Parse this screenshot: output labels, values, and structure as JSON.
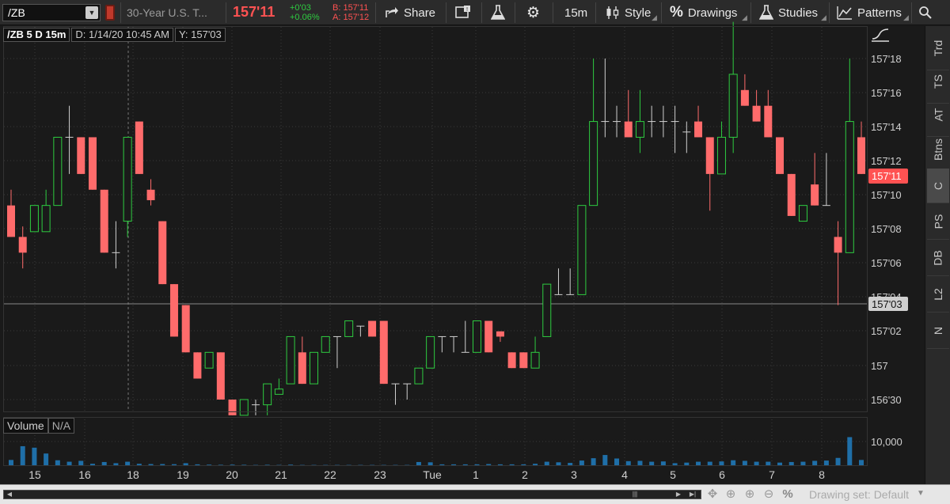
{
  "toolbar": {
    "symbol": "/ZB",
    "description": "30-Year U.S. T...",
    "last_price": "157'11",
    "net_change": "+0'03",
    "pct_change": "+0.06%",
    "bid": "B: 157'11",
    "ask": "A: 157'12",
    "share_label": "Share",
    "timeframe_label": "15m",
    "style_label": "Style",
    "drawings_label": "Drawings",
    "studies_label": "Studies",
    "patterns_label": "Patterns"
  },
  "chart_header": {
    "id": "/ZB 5 D 15m",
    "date": "D: 1/14/20 10:45 AM",
    "y": "Y: 157'03"
  },
  "volume_header": {
    "label": "Volume",
    "value": "N/A"
  },
  "sidebar": {
    "items": [
      "Trd",
      "TS",
      "AT",
      "Btns",
      "C",
      "PS",
      "DB",
      "L2",
      "N"
    ],
    "active": "C"
  },
  "bottombar": {
    "drawing_set": "Drawing set: Default"
  },
  "colors": {
    "up": "#2ecc40",
    "down": "#ff6b6b",
    "grid": "#3a3a3a",
    "bg": "#1a1a1a"
  },
  "chart_data": [
    {
      "type": "candlestick",
      "title": "/ZB 5 D 15m",
      "x_tick_labels": [
        "15",
        "16",
        "18",
        "19",
        "20",
        "21",
        "22",
        "23",
        "Tue",
        "1",
        "2",
        "3",
        "4",
        "5",
        "6",
        "7",
        "8"
      ],
      "y_tick_labels": [
        "156'30",
        "157",
        "157'02",
        "157'04",
        "157'06",
        "157'08",
        "157'10",
        "157'12",
        "157'14",
        "157'16",
        "157'18"
      ],
      "ylim": [
        156.9,
        157.6
      ],
      "last_price_label": "157'11",
      "crosshair_price_label": "157'03",
      "crosshair_value": 157.09,
      "grid": true,
      "candles": [
        {
          "o": 157.31,
          "h": 157.34,
          "l": 157.25,
          "c": 157.25
        },
        {
          "o": 157.25,
          "h": 157.27,
          "l": 157.19,
          "c": 157.22
        },
        {
          "o": 157.26,
          "h": 157.31,
          "l": 157.26,
          "c": 157.31
        },
        {
          "o": 157.26,
          "h": 157.34,
          "l": 157.26,
          "c": 157.31
        },
        {
          "o": 157.31,
          "h": 157.44,
          "l": 157.31,
          "c": 157.44
        },
        {
          "o": 157.44,
          "h": 157.5,
          "l": 157.37,
          "c": 157.44
        },
        {
          "o": 157.44,
          "h": 157.44,
          "l": 157.37,
          "c": 157.37
        },
        {
          "o": 157.44,
          "h": 157.44,
          "l": 157.34,
          "c": 157.34
        },
        {
          "o": 157.34,
          "h": 157.34,
          "l": 157.22,
          "c": 157.22
        },
        {
          "o": 157.22,
          "h": 157.28,
          "l": 157.19,
          "c": 157.22
        },
        {
          "o": 157.28,
          "h": 157.44,
          "l": 157.25,
          "c": 157.44
        },
        {
          "o": 157.47,
          "h": 157.47,
          "l": 157.37,
          "c": 157.37
        },
        {
          "o": 157.34,
          "h": 157.36,
          "l": 157.31,
          "c": 157.32
        },
        {
          "o": 157.28,
          "h": 157.28,
          "l": 157.16,
          "c": 157.16
        },
        {
          "o": 157.16,
          "h": 157.16,
          "l": 157.06,
          "c": 157.06
        },
        {
          "o": 157.12,
          "h": 157.12,
          "l": 157.03,
          "c": 157.03
        },
        {
          "o": 157.03,
          "h": 157.03,
          "l": 156.98,
          "c": 156.98
        },
        {
          "o": 157.0,
          "h": 157.03,
          "l": 157.0,
          "c": 157.03
        },
        {
          "o": 157.03,
          "h": 157.03,
          "l": 156.94,
          "c": 156.94
        },
        {
          "o": 156.94,
          "h": 156.94,
          "l": 156.91,
          "c": 156.91
        },
        {
          "o": 156.91,
          "h": 156.94,
          "l": 156.91,
          "c": 156.94
        },
        {
          "o": 156.93,
          "h": 156.94,
          "l": 156.91,
          "c": 156.93
        },
        {
          "o": 156.93,
          "h": 156.97,
          "l": 156.91,
          "c": 156.97
        },
        {
          "o": 156.95,
          "h": 156.98,
          "l": 156.95,
          "c": 156.96
        },
        {
          "o": 156.97,
          "h": 157.06,
          "l": 156.97,
          "c": 157.06
        },
        {
          "o": 157.03,
          "h": 157.06,
          "l": 156.97,
          "c": 156.97
        },
        {
          "o": 156.97,
          "h": 157.03,
          "l": 156.97,
          "c": 157.03
        },
        {
          "o": 157.03,
          "h": 157.06,
          "l": 157.03,
          "c": 157.06
        },
        {
          "o": 157.06,
          "h": 157.06,
          "l": 157.0,
          "c": 157.06
        },
        {
          "o": 157.06,
          "h": 157.09,
          "l": 157.06,
          "c": 157.09
        },
        {
          "o": 157.08,
          "h": 157.08,
          "l": 157.06,
          "c": 157.08
        },
        {
          "o": 157.09,
          "h": 157.09,
          "l": 157.06,
          "c": 157.06
        },
        {
          "o": 157.09,
          "h": 157.09,
          "l": 156.97,
          "c": 156.97
        },
        {
          "o": 156.97,
          "h": 156.97,
          "l": 156.93,
          "c": 156.97
        },
        {
          "o": 156.97,
          "h": 156.97,
          "l": 156.94,
          "c": 156.97
        },
        {
          "o": 156.97,
          "h": 157.0,
          "l": 156.97,
          "c": 157.0
        },
        {
          "o": 157.0,
          "h": 157.06,
          "l": 157.0,
          "c": 157.06
        },
        {
          "o": 157.06,
          "h": 157.06,
          "l": 157.03,
          "c": 157.06
        },
        {
          "o": 157.06,
          "h": 157.06,
          "l": 157.03,
          "c": 157.06
        },
        {
          "o": 157.03,
          "h": 157.09,
          "l": 157.03,
          "c": 157.03
        },
        {
          "o": 157.03,
          "h": 157.09,
          "l": 157.03,
          "c": 157.09
        },
        {
          "o": 157.09,
          "h": 157.09,
          "l": 157.03,
          "c": 157.03
        },
        {
          "o": 157.07,
          "h": 157.07,
          "l": 157.05,
          "c": 157.06
        },
        {
          "o": 157.03,
          "h": 157.03,
          "l": 157.0,
          "c": 157.0
        },
        {
          "o": 157.03,
          "h": 157.03,
          "l": 157.0,
          "c": 157.0
        },
        {
          "o": 157.0,
          "h": 157.06,
          "l": 157.0,
          "c": 157.03
        },
        {
          "o": 157.06,
          "h": 157.16,
          "l": 157.06,
          "c": 157.16
        },
        {
          "o": 157.14,
          "h": 157.19,
          "l": 157.14,
          "c": 157.14
        },
        {
          "o": 157.14,
          "h": 157.19,
          "l": 157.14,
          "c": 157.14
        },
        {
          "o": 157.14,
          "h": 157.31,
          "l": 157.14,
          "c": 157.31
        },
        {
          "o": 157.31,
          "h": 157.59,
          "l": 157.31,
          "c": 157.47
        },
        {
          "o": 157.47,
          "h": 157.59,
          "l": 157.44,
          "c": 157.47
        },
        {
          "o": 157.47,
          "h": 157.5,
          "l": 157.44,
          "c": 157.47
        },
        {
          "o": 157.47,
          "h": 157.53,
          "l": 157.44,
          "c": 157.44
        },
        {
          "o": 157.44,
          "h": 157.53,
          "l": 157.41,
          "c": 157.47
        },
        {
          "o": 157.47,
          "h": 157.5,
          "l": 157.44,
          "c": 157.47
        },
        {
          "o": 157.47,
          "h": 157.5,
          "l": 157.44,
          "c": 157.47
        },
        {
          "o": 157.47,
          "h": 157.5,
          "l": 157.41,
          "c": 157.47
        },
        {
          "o": 157.45,
          "h": 157.47,
          "l": 157.41,
          "c": 157.45
        },
        {
          "o": 157.47,
          "h": 157.5,
          "l": 157.44,
          "c": 157.44
        },
        {
          "o": 157.44,
          "h": 157.44,
          "l": 157.3,
          "c": 157.37
        },
        {
          "o": 157.37,
          "h": 157.47,
          "l": 157.37,
          "c": 157.44
        },
        {
          "o": 157.44,
          "h": 157.66,
          "l": 157.41,
          "c": 157.56
        },
        {
          "o": 157.53,
          "h": 157.56,
          "l": 157.5,
          "c": 157.5
        },
        {
          "o": 157.5,
          "h": 157.53,
          "l": 157.47,
          "c": 157.47
        },
        {
          "o": 157.5,
          "h": 157.53,
          "l": 157.44,
          "c": 157.44
        },
        {
          "o": 157.44,
          "h": 157.44,
          "l": 157.37,
          "c": 157.37
        },
        {
          "o": 157.37,
          "h": 157.37,
          "l": 157.29,
          "c": 157.29
        },
        {
          "o": 157.28,
          "h": 157.31,
          "l": 157.28,
          "c": 157.31
        },
        {
          "o": 157.35,
          "h": 157.41,
          "l": 157.31,
          "c": 157.31
        },
        {
          "o": 157.31,
          "h": 157.41,
          "l": 157.31,
          "c": 157.31
        },
        {
          "o": 157.25,
          "h": 157.28,
          "l": 157.12,
          "c": 157.22
        },
        {
          "o": 157.22,
          "h": 157.59,
          "l": 157.22,
          "c": 157.47
        },
        {
          "o": 157.44,
          "h": 157.47,
          "l": 157.37,
          "c": 157.37
        }
      ]
    },
    {
      "type": "bar",
      "title": "Volume",
      "y_tick_labels": [
        "10,000"
      ],
      "values": [
        1800,
        6500,
        6000,
        4000,
        1700,
        1200,
        1500,
        500,
        1100,
        700,
        1200,
        500,
        400,
        400,
        350,
        700,
        300,
        200,
        150,
        200,
        150,
        100,
        150,
        100,
        200,
        100,
        100,
        100,
        100,
        100,
        100,
        100,
        100,
        100,
        100,
        1100,
        1000,
        300,
        300,
        300,
        300,
        400,
        300,
        300,
        300,
        500,
        1200,
        1000,
        800,
        1600,
        2400,
        3500,
        2300,
        1400,
        1500,
        1200,
        1300,
        700,
        900,
        1200,
        1200,
        1300,
        1700,
        1500,
        1200,
        1200,
        900,
        1100,
        1200,
        1500,
        1600,
        2500,
        9600,
        1800
      ],
      "ylim": [
        0,
        10000
      ]
    }
  ]
}
